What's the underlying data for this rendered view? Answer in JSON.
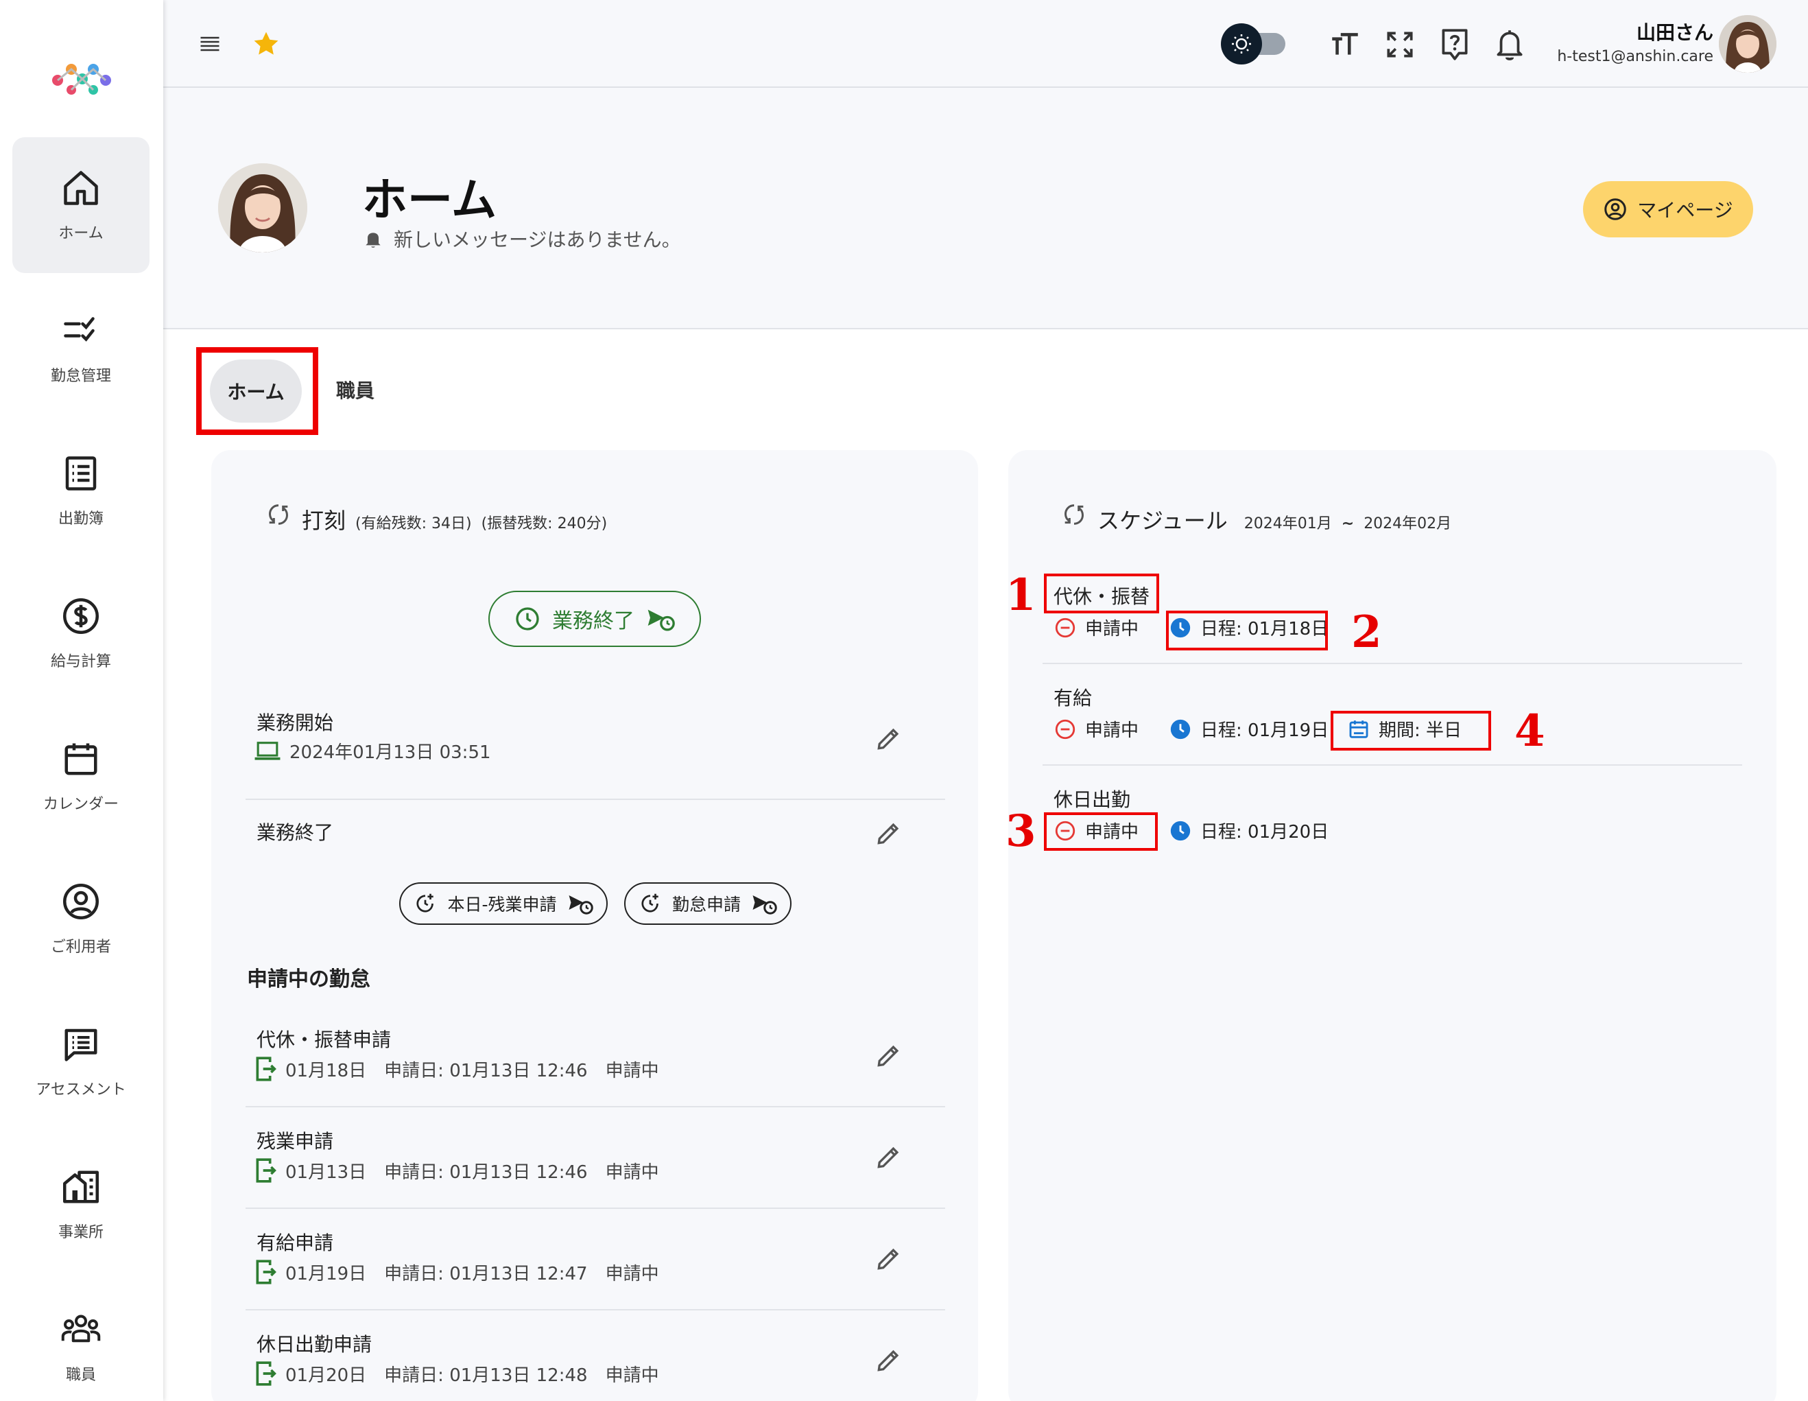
{
  "sidebar": {
    "items": [
      {
        "label": "ホーム",
        "icon": "home-icon"
      },
      {
        "label": "勤怠管理",
        "icon": "checklist-icon"
      },
      {
        "label": "出勤簿",
        "icon": "list-icon"
      },
      {
        "label": "給与計算",
        "icon": "dollar-icon"
      },
      {
        "label": "カレンダー",
        "icon": "calendar-icon"
      },
      {
        "label": "ご利用者",
        "icon": "account-icon"
      },
      {
        "label": "アセスメント",
        "icon": "comment-list-icon"
      },
      {
        "label": "事業所",
        "icon": "building-icon"
      },
      {
        "label": "職員",
        "icon": "group-icon"
      }
    ]
  },
  "topbar": {
    "user_name": "山田さん",
    "user_email": "h-test1@anshin.care"
  },
  "header": {
    "title": "ホーム",
    "message": "新しいメッセージはありません。",
    "mypage_label": "マイページ"
  },
  "tabs": {
    "home": "ホーム",
    "staff": "職員"
  },
  "stamp": {
    "title": "打刻",
    "paid_leave": "(有給残数: 34日)",
    "transfer": "(振替残数: 240分)",
    "end_button": "業務終了",
    "start_label": "業務開始",
    "start_time": "2024年01月13日 03:51",
    "end_label": "業務終了",
    "overtime_button": "本日-残業申請",
    "attendance_button": "勤怠申請",
    "pending_title": "申請中の勤怠",
    "pending": [
      {
        "title": "代休・振替申請",
        "date": "01月18日",
        "applied": "申請日: 01月13日 12:46",
        "status": "申請中"
      },
      {
        "title": "残業申請",
        "date": "01月13日",
        "applied": "申請日: 01月13日 12:46",
        "status": "申請中"
      },
      {
        "title": "有給申請",
        "date": "01月19日",
        "applied": "申請日: 01月13日 12:47",
        "status": "申請中"
      },
      {
        "title": "休日出勤申請",
        "date": "01月20日",
        "applied": "申請日: 01月13日 12:48",
        "status": "申請中"
      }
    ]
  },
  "schedule": {
    "title": "スケジュール",
    "range_from": "2024年01月",
    "range_sep": "~",
    "range_to": "2024年02月",
    "items": [
      {
        "title": "代休・振替",
        "status": "申請中",
        "date": "日程: 01月18日"
      },
      {
        "title": "有給",
        "status": "申請中",
        "date": "日程: 01月19日",
        "period": "期間: 半日"
      },
      {
        "title": "休日出勤",
        "status": "申請中",
        "date": "日程: 01月20日"
      }
    ]
  },
  "annotations": [
    "1",
    "2",
    "3",
    "4"
  ],
  "colors": {
    "accent_yellow": "#fdd46c",
    "green": "#2e7d32",
    "red": "#e53935",
    "blue": "#1976d2",
    "annotation_red": "#ee0000",
    "star": "#f5b50a"
  }
}
